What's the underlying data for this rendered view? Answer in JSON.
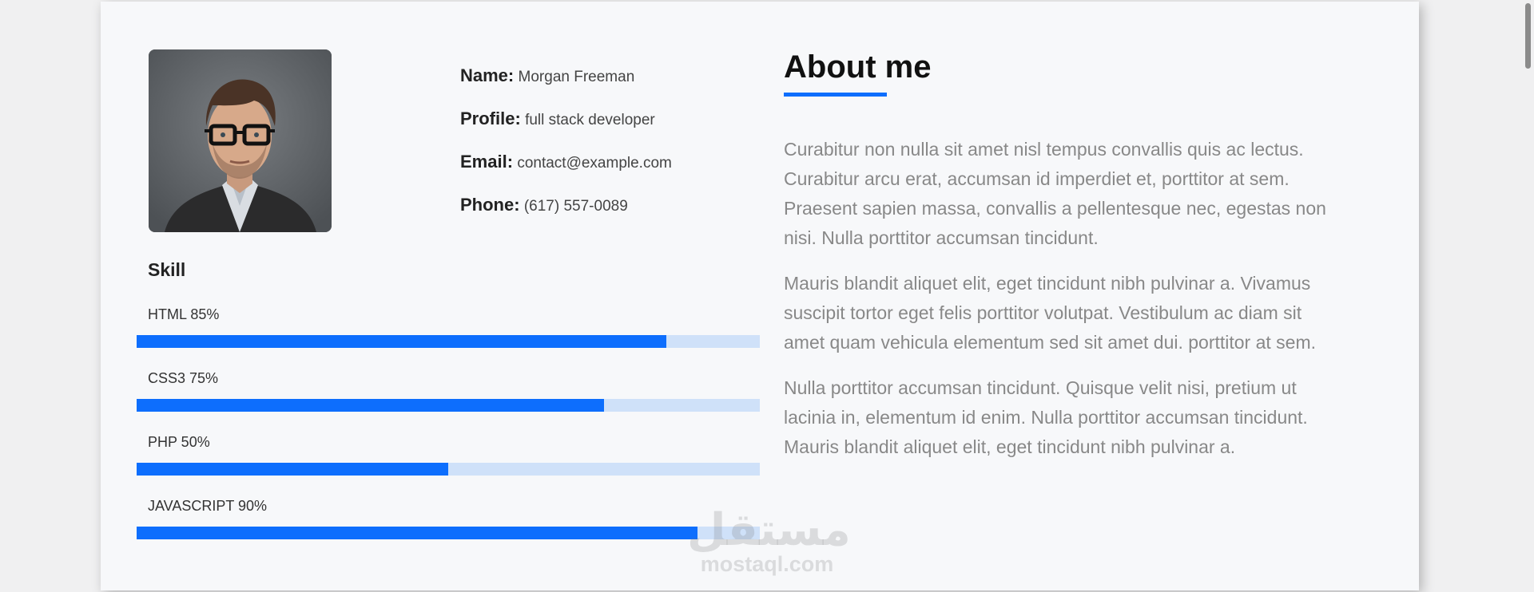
{
  "profile": {
    "photo_alt": "profile-photo",
    "details": [
      {
        "key": "Name:",
        "value": "Morgan Freeman"
      },
      {
        "key": "Profile:",
        "value": "full stack developer"
      },
      {
        "key": "Email:",
        "value": "contact@example.com"
      },
      {
        "key": "Phone:",
        "value": "(617) 557-0089"
      }
    ]
  },
  "skills": {
    "title": "Skill",
    "items": [
      {
        "label": "HTML 85%",
        "percent": 85
      },
      {
        "label": "CSS3 75%",
        "percent": 75
      },
      {
        "label": "PHP 50%",
        "percent": 50
      },
      {
        "label": "JAVASCRIPT 90%",
        "percent": 90
      }
    ]
  },
  "about": {
    "title": "About me",
    "paragraphs": [
      "Curabitur non nulla sit amet nisl tempus convallis quis ac lectus. Curabitur arcu erat, accumsan id imperdiet et, porttitor at sem. Praesent sapien massa, convallis a pellentesque nec, egestas non nisi. Nulla porttitor accumsan tincidunt.",
      "Mauris blandit aliquet elit, eget tincidunt nibh pulvinar a. Vivamus suscipit tortor eget felis porttitor volutpat. Vestibulum ac diam sit amet quam vehicula elementum sed sit amet dui. porttitor at sem.",
      "Nulla porttitor accumsan tincidunt. Quisque velit nisi, pretium ut lacinia in, elementum id enim. Nulla porttitor accumsan tincidunt. Mauris blandit aliquet elit, eget tincidunt nibh pulvinar a."
    ]
  },
  "watermark": {
    "arabic": "مستقل",
    "latin": "mostaql.com"
  },
  "colors": {
    "accent": "#0d6efd",
    "bar_track": "#cfe1f9",
    "card_bg": "#f7f8fa",
    "page_bg": "#f0f0f1"
  }
}
